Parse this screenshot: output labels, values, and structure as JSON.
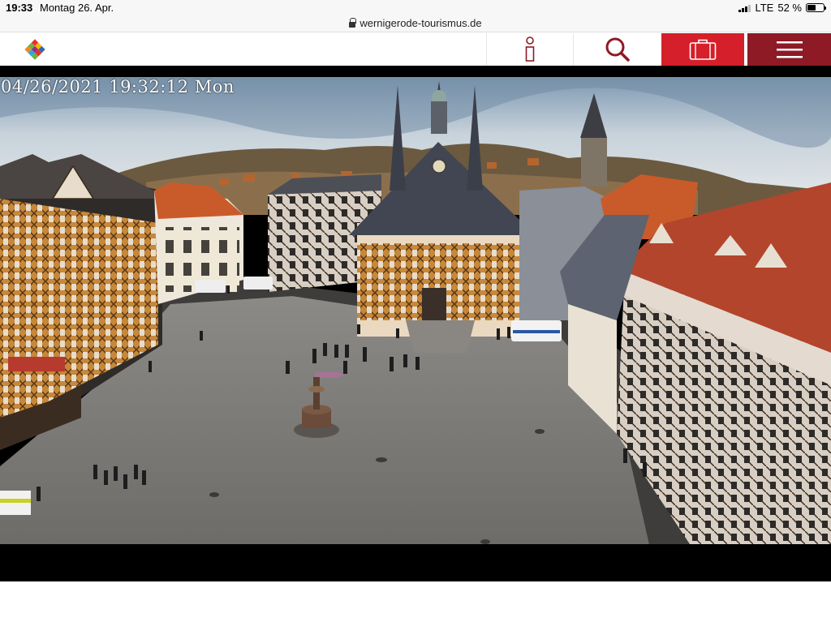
{
  "status_bar": {
    "time": "19:33",
    "date": "Montag 26. Apr.",
    "network": "LTE",
    "battery": "52 %",
    "battery_level": 0.52
  },
  "browser": {
    "url": "wernigerode-tourismus.de"
  },
  "header": {
    "logo_icon": "colorful-diamond-logo-icon",
    "buttons": [
      {
        "name": "info-button",
        "icon": "info-icon"
      },
      {
        "name": "search-button",
        "icon": "search-icon"
      },
      {
        "name": "bag-button",
        "icon": "suitcase-icon"
      },
      {
        "name": "menu-button",
        "icon": "hamburger-menu-icon"
      }
    ],
    "colors": {
      "bag_bg": "#d51f2a",
      "menu_bg": "#8e1a26",
      "accent": "#8e1a26"
    }
  },
  "webcam": {
    "timestamp": "04/26/2021 19:32:12 Mon"
  }
}
